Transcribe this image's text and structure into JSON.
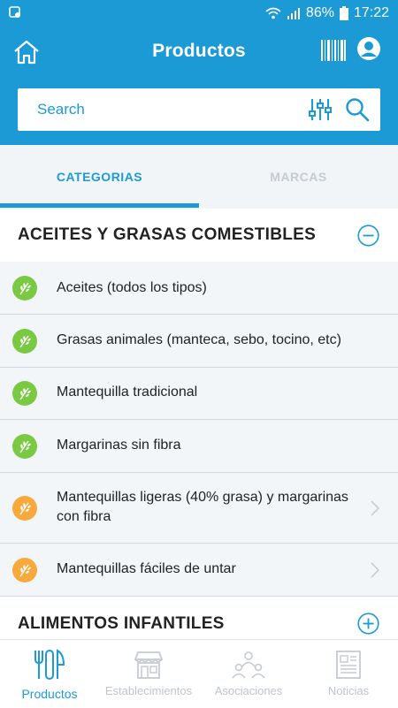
{
  "status": {
    "battery_pct": "86%",
    "time": "17:22"
  },
  "header": {
    "title": "Productos"
  },
  "search": {
    "placeholder": "Search"
  },
  "tabs": {
    "active": "CATEGORIAS",
    "inactive": "MARCAS"
  },
  "sections": [
    {
      "title": "ACEITES Y GRASAS COMESTIBLES",
      "items": [
        {
          "label": "Aceites (todos los tipos)",
          "badge_color": "#7ac943"
        },
        {
          "label": "Grasas animales (manteca, sebo, tocino, etc)",
          "badge_color": "#7ac943"
        },
        {
          "label": "Mantequilla tradicional",
          "badge_color": "#7ac943"
        },
        {
          "label": "Margarinas sin fibra",
          "badge_color": "#7ac943"
        },
        {
          "label": "Mantequillas ligeras (40% grasa) y margarinas con fibra",
          "badge_color": "#f8a93c"
        },
        {
          "label": "Mantequillas fáciles de untar",
          "badge_color": "#f8a93c"
        }
      ]
    },
    {
      "title": "ALIMENTOS INFANTILES"
    }
  ],
  "nav": [
    {
      "label": "Productos",
      "icon": "fork-knife-icon",
      "active": true
    },
    {
      "label": "Establecimientos",
      "icon": "store-icon"
    },
    {
      "label": "Asociaciones",
      "icon": "people-icon"
    },
    {
      "label": "Noticias",
      "icon": "newspaper-icon"
    }
  ],
  "colors": {
    "primary": "#1b9ad6",
    "green": "#7ac943",
    "orange": "#f8a93c"
  }
}
